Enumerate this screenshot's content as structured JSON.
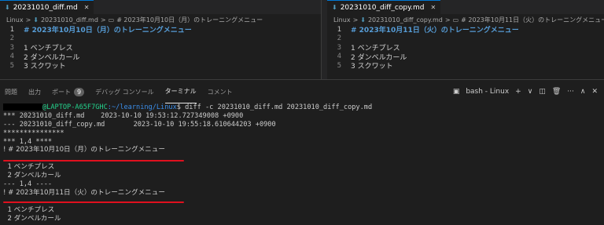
{
  "editor_left": {
    "tab_label": "20231010_diff.md",
    "breadcrumb": [
      "Linux",
      ">",
      "20231010_diff.md",
      ">",
      "# 2023年10月10日（月）のトレーニングメニュー"
    ],
    "lines": [
      {
        "num": "1",
        "text": "# 2023年10月10日（月）のトレーニングメニュー"
      },
      {
        "num": "2",
        "text": ""
      },
      {
        "num": "3",
        "text": "1 ベンチプレス"
      },
      {
        "num": "4",
        "text": "2 ダンベルカール"
      },
      {
        "num": "5",
        "text": "3 スクワット"
      }
    ]
  },
  "editor_right": {
    "tab_label": "20231010_diff_copy.md",
    "breadcrumb": [
      "Linux",
      ">",
      "20231010_diff_copy.md",
      ">",
      "# 2023年10月11日（火）のトレーニングメニュー"
    ],
    "lines": [
      {
        "num": "1",
        "text": "# 2023年10月11日（火）のトレーニングメニュー"
      },
      {
        "num": "2",
        "text": ""
      },
      {
        "num": "3",
        "text": "1 ベンチプレス"
      },
      {
        "num": "4",
        "text": "2 ダンベルカール"
      },
      {
        "num": "5",
        "text": "3 スクワット"
      }
    ]
  },
  "panel": {
    "tabs": [
      {
        "label": "問題"
      },
      {
        "label": "出力"
      },
      {
        "label": "ポート",
        "badge": "9"
      },
      {
        "label": "デバッグ コンソール"
      },
      {
        "label": "ターミナル"
      },
      {
        "label": "コメント"
      }
    ],
    "shell_label": "bash - Linux",
    "tools": [
      "+",
      "∨",
      "◫",
      "🗑",
      "···",
      "∧",
      "✕"
    ]
  },
  "terminal": {
    "prompt_host": "@LAPTOP-A65F7GHC",
    "prompt_path": ":~/learning/Linux",
    "prompt_symbol": "$",
    "command": " diff -c 20231010_diff.md 20231010_diff_copy.md",
    "lines": [
      "*** 20231010_diff.md    2023-10-10 19:53:12.727349008 +0900",
      "--- 20231010_diff_copy.md       2023-10-10 19:55:18.610644203 +0900",
      "***************",
      "*** 1,4 ****",
      "! # 2023年10月10日（月）のトレーニングメニュー",
      "",
      "  1 ベンチプレス",
      "  2 ダンベルカール",
      "--- 1,4 ----",
      "! # 2023年10月11日（火）のトレーニングメニュー",
      "",
      "  1 ベンチプレス",
      "  2 ダンベルカール"
    ]
  },
  "colors": {
    "accent": "#0078d4",
    "heading": "#569cd6",
    "prompt_host": "#23d18b",
    "prompt_path": "#3b8eea",
    "annotation_red": "#e0101e"
  }
}
